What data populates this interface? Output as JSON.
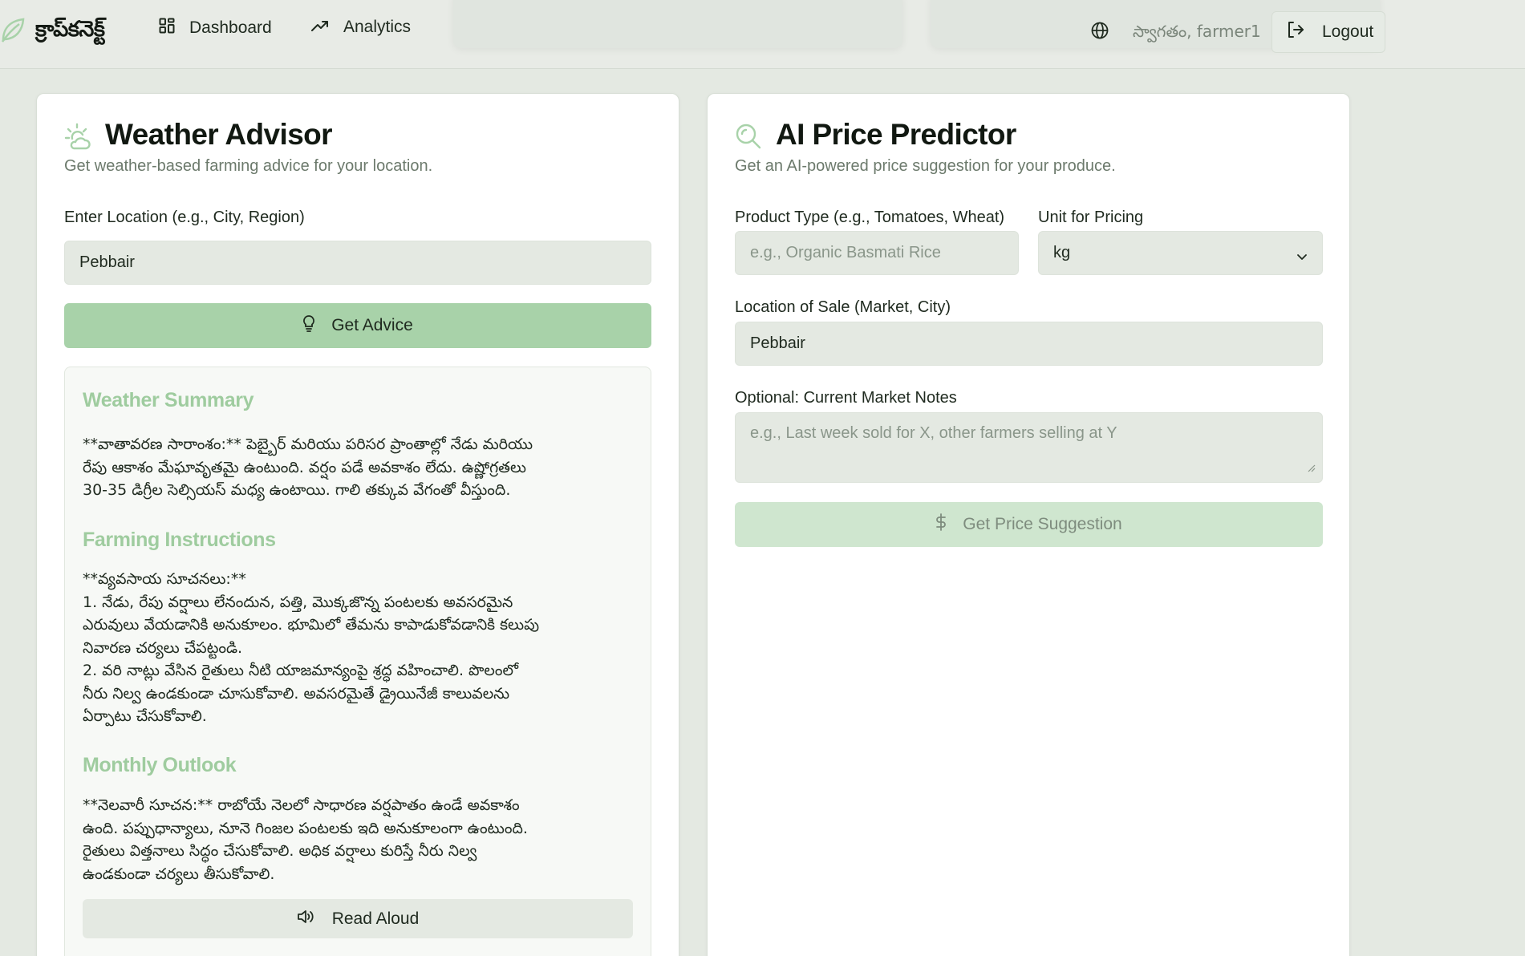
{
  "header": {
    "brand": "క్రాప్‌కనెక్ట్",
    "nav": [
      {
        "label": "Dashboard",
        "icon": "dashboard-grid-icon"
      },
      {
        "label": "Analytics",
        "icon": "trending-up-icon"
      }
    ],
    "language_icon": "globe-icon",
    "welcome": "స్వాగతం, farmer1",
    "logout_label": "Logout"
  },
  "weather": {
    "title": "Weather Advisor",
    "subtitle": "Get weather-based farming advice for your location.",
    "location_label": "Enter Location (e.g., City, Region)",
    "location_value": "Pebbair",
    "get_advice_label": "Get Advice",
    "summary_heading": "Weather Summary",
    "summary_text": "**వాతావరణ సారాంశం:** పెబ్బైర్ మరియు పరిసర ప్రాంతాల్లో నేడు మరియు\nరేపు ఆకాశం మేఘావృతమై ఉంటుంది. వర్షం పడే అవకాశం లేదు. ఉష్ణోగ్రతలు\n30-35 డిగ్రీల సెల్సియస్ మధ్య ఉంటాయి. గాలి తక్కువ వేగంతో వీస్తుంది.",
    "instructions_heading": "Farming Instructions",
    "instructions_text": "**వ్యవసాయ సూచనలు:**\n1. నేడు, రేపు వర్షాలు లేనందున, పత్తి, మొక్కజొన్న పంటలకు అవసరమైన\nఎరువులు వేయడానికి అనుకూలం. భూమిలో తేమను కాపాడుకోవడానికి కలుపు\nనివారణ చర్యలు చేపట్టండి.\n2. వరి నాట్లు వేసిన రైతులు నీటి యాజమాన్యంపై శ్రద్ధ వహించాలి. పొలంలో\nనీరు నిల్వ ఉండకుండా చూసుకోవాలి. అవసరమైతే డ్రైయినేజీ కాలువలను\nఏర్పాటు చేసుకోవాలి.",
    "outlook_heading": "Monthly Outlook",
    "outlook_text": "**నెలవారీ సూచన:** రాబోయే నెలలో సాధారణ వర్షపాతం ఉండే అవకాశం\nఉంది. పప్పుధాన్యాలు, నూనె గింజల పంటలకు ఇది అనుకూలంగా ఉంటుంది.\nరైతులు విత్తనాలు సిద్ధం చేసుకోవాలి. అధిక వర్షాలు కురిస్తే నీరు నిల్వ\nఉండకుండా చర్యలు తీసుకోవాలి.",
    "read_aloud_label": "Read Aloud"
  },
  "price": {
    "title": "AI Price Predictor",
    "subtitle": "Get an AI-powered price suggestion for your produce.",
    "product_label": "Product Type (e.g., Tomatoes, Wheat)",
    "product_placeholder": "e.g., Organic Basmati Rice",
    "unit_label": "Unit for Pricing",
    "unit_value": "kg",
    "location_label": "Location of Sale (Market, City)",
    "location_value": "Pebbair",
    "notes_label": "Optional: Current Market Notes",
    "notes_placeholder": "e.g., Last week sold for X, other farmers selling at Y",
    "suggest_label": "Get Price Suggestion"
  },
  "colors": {
    "accent": "#a8d2a9",
    "heading_green": "#9fcc9f",
    "background": "#e4e9e2"
  }
}
